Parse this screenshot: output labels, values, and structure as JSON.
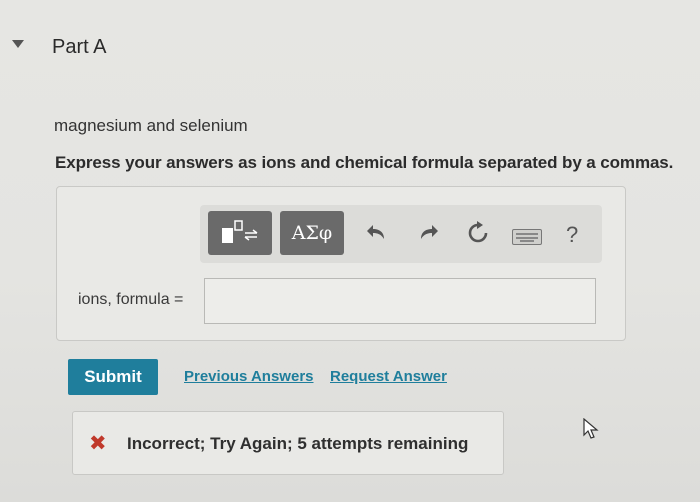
{
  "part": {
    "title": "Part A"
  },
  "question": {
    "prompt": "magnesium and selenium",
    "instruction": "Express your answers as ions and chemical formula separated by a commas."
  },
  "toolbar": {
    "symbols_label": "ΑΣφ",
    "help_label": "?",
    "icons": [
      "templates-icon",
      "undo-icon",
      "redo-icon",
      "reset-icon",
      "keyboard-icon",
      "help-icon"
    ]
  },
  "answer": {
    "label": "ions, formula =",
    "value": ""
  },
  "actions": {
    "submit_label": "Submit",
    "previous_answers_label": "Previous Answers",
    "request_answer_label": "Request Answer"
  },
  "feedback": {
    "message": "Incorrect; Try Again; 5 attempts remaining",
    "status_color": "#c0392b"
  },
  "colors": {
    "accent": "#1f7e9c",
    "toolbar_button": "#6a6a6a"
  }
}
